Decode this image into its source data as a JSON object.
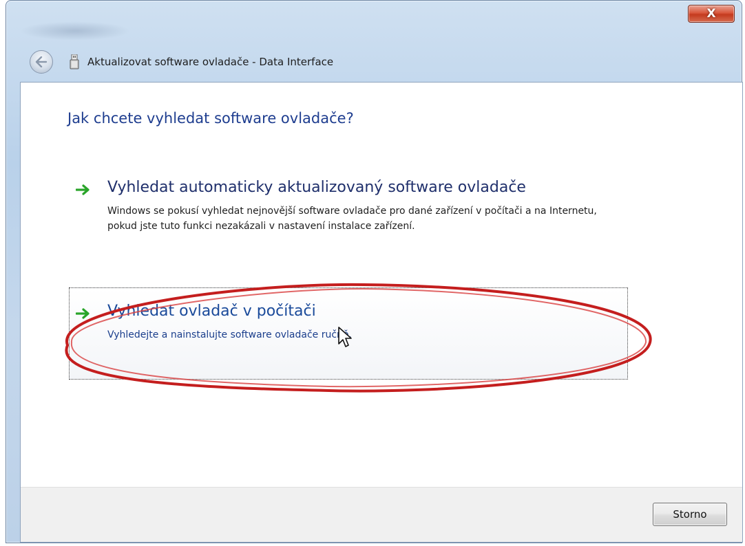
{
  "window": {
    "title": "Aktualizovat software ovladače - Data Interface",
    "close_glyph": "X"
  },
  "dialog": {
    "heading": "Jak chcete vyhledat software ovladače?",
    "options": [
      {
        "title": "Vyhledat automaticky aktualizovaný software ovladače",
        "description": "Windows se pokusí vyhledat nejnovější software ovladače pro dané zařízení v počítači a na Internetu, pokud jste tuto funkci nezakázali v nastavení instalace zařízení.",
        "icon": "green-arrow-icon"
      },
      {
        "title": "Vyhledat ovladač v počítači",
        "description": "Vyhledejte a nainstalujte software ovladače ručně.",
        "icon": "green-arrow-icon",
        "highlighted": true
      }
    ]
  },
  "footer": {
    "cancel_label": "Storno"
  },
  "colors": {
    "heading": "#1e3d8f",
    "annotation": "#c41e1e",
    "arrow": "#2aa52a"
  },
  "icons": {
    "back": "back-arrow-icon",
    "device": "usb-device-icon",
    "close": "close-icon",
    "cursor": "mouse-pointer-icon"
  }
}
